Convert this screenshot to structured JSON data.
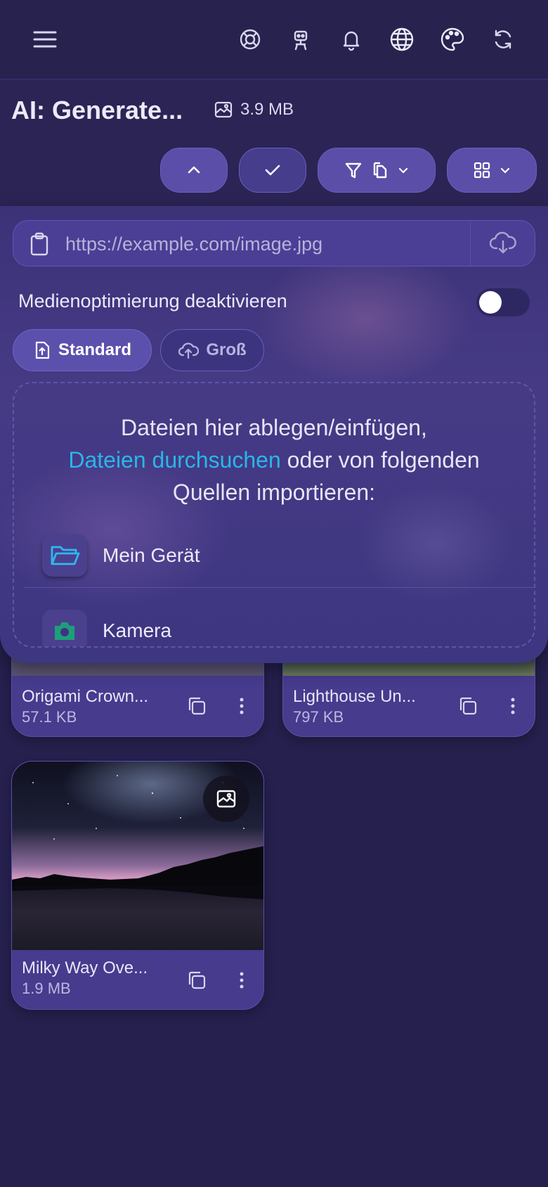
{
  "topbar": {
    "icons": [
      "menu-icon",
      "support-icon",
      "robot-icon",
      "bell-icon",
      "globe-icon",
      "palette-icon",
      "refresh-icon"
    ]
  },
  "header": {
    "title": "AI: Generate...",
    "size": "3.9 MB"
  },
  "panel": {
    "url_placeholder": "https://example.com/image.jpg",
    "toggle_label": "Medienoptimierung deaktivieren",
    "toggle_on": false,
    "modes": [
      {
        "label": "Standard",
        "active": true
      },
      {
        "label": "Groß",
        "active": false
      }
    ],
    "dropzone": {
      "line1": "Dateien hier ablegen/einfügen,",
      "link": "Dateien durchsuchen",
      "line2_rest": " oder von folgenden",
      "line3": "Quellen importieren:"
    },
    "sources": [
      {
        "label": "Mein Gerät",
        "icon": "folder-icon"
      },
      {
        "label": "Kamera",
        "icon": "camera-icon"
      }
    ]
  },
  "files": [
    {
      "name": "Origami Crown...",
      "size": "57.1 KB"
    },
    {
      "name": "Lighthouse Un...",
      "size": "797 KB"
    },
    {
      "name": "Milky Way Ove...",
      "size": "1.9 MB"
    }
  ],
  "colors": {
    "background": "#25204d",
    "accent": "#5a4ea8",
    "link": "#29b6e8"
  }
}
